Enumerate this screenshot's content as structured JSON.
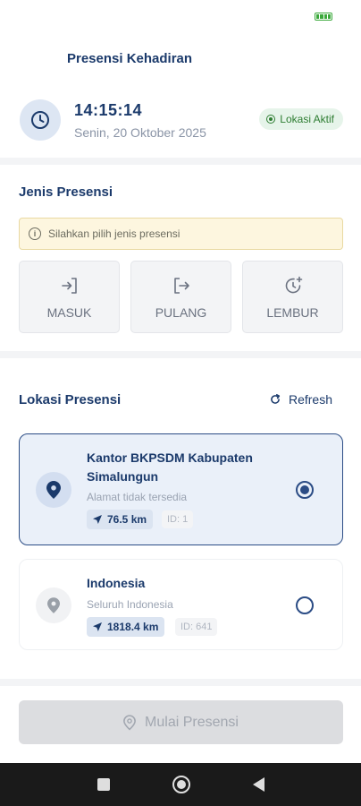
{
  "header": {
    "title": "Presensi Kehadiran",
    "time": "14:15:14",
    "date": "Senin, 20 Oktober 2025",
    "location_status": "Lokasi Aktif"
  },
  "jenis": {
    "title": "Jenis Presensi",
    "info": "Silahkan pilih jenis presensi",
    "buttons": [
      {
        "label": "MASUK",
        "icon": "login-icon"
      },
      {
        "label": "PULANG",
        "icon": "logout-icon"
      },
      {
        "label": "LEMBUR",
        "icon": "overtime-icon"
      }
    ]
  },
  "lokasi": {
    "title": "Lokasi Presensi",
    "refresh_label": "Refresh",
    "items": [
      {
        "name": "Kantor BKPSDM Kabupaten Simalungun",
        "address": "Alamat tidak tersedia",
        "distance": "76.5 km",
        "id": "ID: 1",
        "selected": true
      },
      {
        "name": "Indonesia",
        "address": "Seluruh Indonesia",
        "distance": "1818.4 km",
        "id": "ID: 641",
        "selected": false
      }
    ]
  },
  "action": {
    "start_label": "Mulai Presensi"
  },
  "colors": {
    "primary": "#1b3a6b",
    "accent": "#2b4c85",
    "success": "#2e7d32",
    "warning_bg": "#fdf6df"
  }
}
